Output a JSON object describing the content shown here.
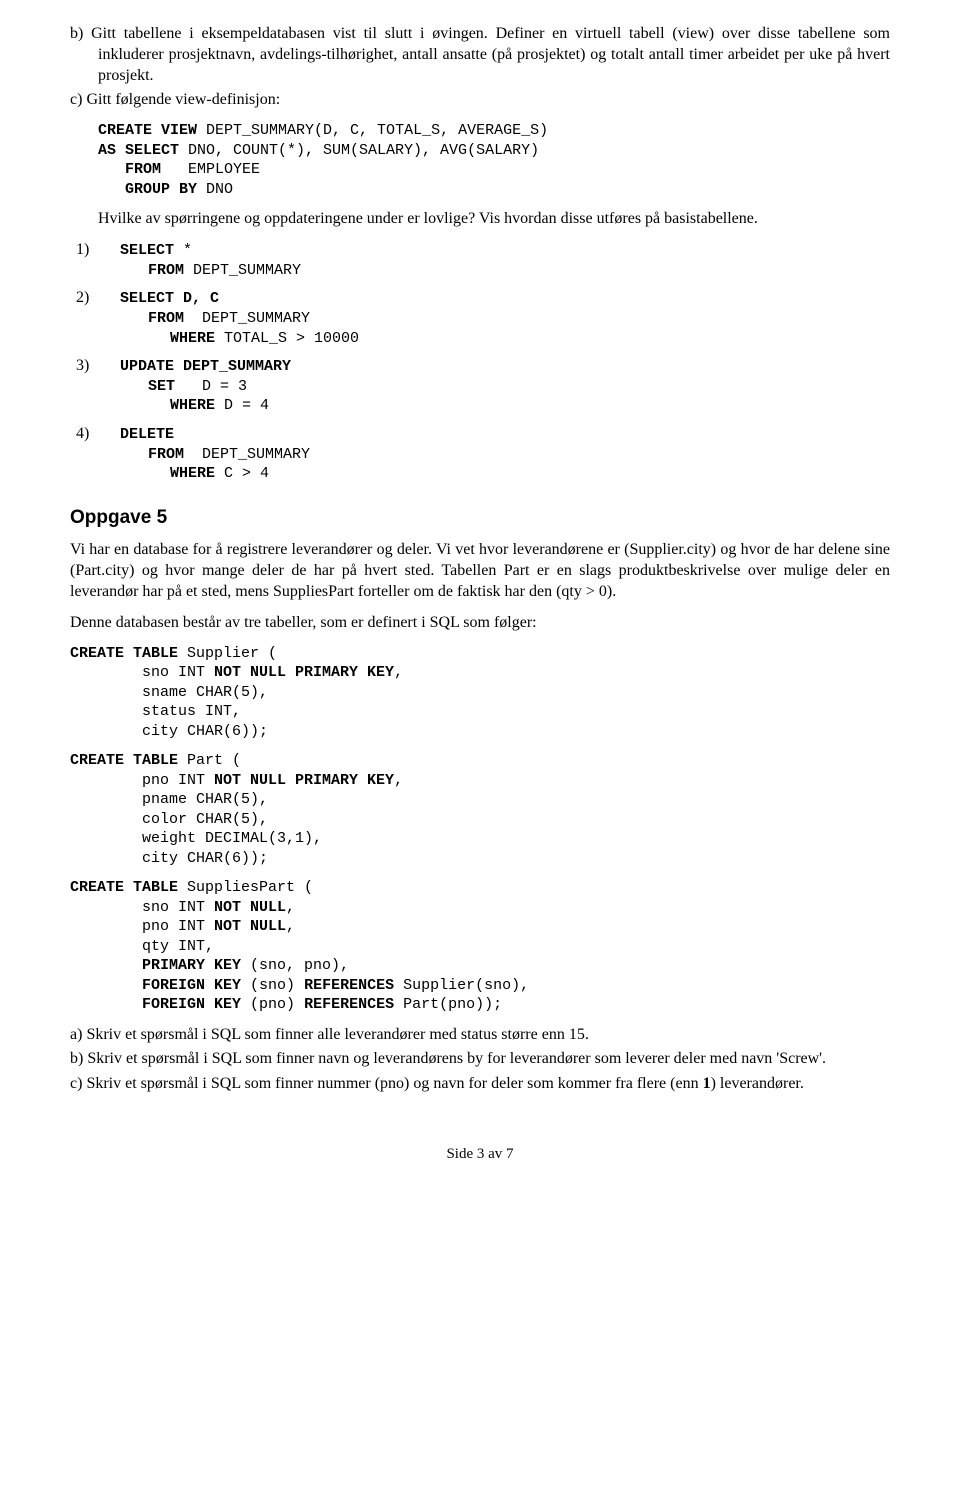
{
  "item_b": {
    "label": "b)",
    "text": "Gitt tabellene i eksempeldatabasen vist til slutt i øvingen. Definer en virtuell tabell (view) over disse tabellene som inkluderer prosjektnavn, avdelings-tilhørighet, antall ansatte (på prosjektet) og totalt antall timer arbeidet per uke på hvert prosjekt."
  },
  "item_c": {
    "label": "c)",
    "text": "Gitt følgende view-definisjon:",
    "code_line1a": "CREATE VIEW",
    "code_line1b": " DEPT_SUMMARY(D, C, TOTAL_S, AVERAGE_S)",
    "code_line2a": "AS SELECT",
    "code_line2b": " DNO, COUNT(*), SUM(SALARY), AVG(SALARY)",
    "code_line3a": "   FROM",
    "code_line3b": "   EMPLOYEE",
    "code_line4a": "   GROUP BY",
    "code_line4b": " DNO",
    "para2": "Hvilke av spørringene og oppdateringene under er lovlige? Vis hvordan disse utføres på basistabellene."
  },
  "q1": {
    "label": "1)",
    "l1a": "SELECT",
    "l1b": " *",
    "l2a": "FROM",
    "l2b": " DEPT_SUMMARY"
  },
  "q2": {
    "label": "2)",
    "l1a": "SELECT D, C",
    "l2a": "FROM",
    "l2b": "  DEPT_SUMMARY",
    "l3a": "WHERE",
    "l3b": " TOTAL_S > 10000"
  },
  "q3": {
    "label": "3)",
    "l1a": "UPDATE DEPT_SUMMARY",
    "l2a": "SET",
    "l2b": "   D = 3",
    "l3a": "WHERE",
    "l3b": " D = 4"
  },
  "q4": {
    "label": "4)",
    "l1a": "DELETE",
    "l2a": "FROM",
    "l2b": "  DEPT_SUMMARY",
    "l3a": "WHERE",
    "l3b": " C > 4"
  },
  "oppgave5": {
    "title": "Oppgave 5",
    "p1": "Vi har en database for å registrere leverandører og deler. Vi vet hvor leverandørene er (Supplier.city) og hvor de har delene sine (Part.city) og hvor mange deler de har på hvert sted. Tabellen Part er en slags produktbeskrivelse over mulige deler en leverandør har på et sted, mens SuppliesPart forteller om de faktisk har den (qty > 0).",
    "p2": "Denne databasen består av tre tabeller, som er definert i SQL som følger:"
  },
  "supplier": {
    "l1a": "CREATE TABLE",
    "l1b": " Supplier (",
    "l2": "        sno INT ",
    "l2b": "NOT NULL PRIMARY KEY",
    "l2c": ",",
    "l3": "        sname CHAR(5),",
    "l4": "        status INT,",
    "l5": "        city CHAR(6));"
  },
  "part": {
    "l1a": "CREATE TABLE",
    "l1b": " Part (",
    "l2": "        pno INT ",
    "l2b": "NOT NULL PRIMARY KEY",
    "l2c": ",",
    "l3": "        pname CHAR(5),",
    "l4": "        color CHAR(5),",
    "l5": "        weight DECIMAL(3,1),",
    "l6": "        city CHAR(6));"
  },
  "suppliespart": {
    "l1a": "CREATE TABLE",
    "l1b": " SuppliesPart (",
    "l2": "        sno INT ",
    "l2b": "NOT NULL",
    "l2c": ",",
    "l3": "        pno INT ",
    "l3b": "NOT NULL",
    "l3c": ",",
    "l4": "        qty INT,",
    "l5a": "        ",
    "l5b": "PRIMARY KEY",
    "l5c": " (sno, pno),",
    "l6a": "        ",
    "l6b": "FOREIGN KEY",
    "l6c": " (sno) ",
    "l6d": "REFERENCES",
    "l6e": " Supplier(sno),",
    "l7a": "        ",
    "l7b": "FOREIGN KEY",
    "l7c": " (pno) ",
    "l7d": "REFERENCES",
    "l7e": " Part(pno));"
  },
  "task_a": {
    "label": "a)",
    "text": "Skriv et spørsmål i SQL som finner alle leverandører med status større enn 15."
  },
  "task_b": {
    "label": "b)",
    "text": "Skriv et spørsmål i SQL som finner navn og leverandørens by for leverandører som leverer deler med navn 'Screw'."
  },
  "task_c": {
    "label": "c)",
    "text1": "Skriv et spørsmål i SQL som finner nummer (pno) og navn for deler som kommer fra flere (enn ",
    "text_bold": "1",
    "text2": ") leverandører."
  },
  "footer": "Side 3 av 7"
}
